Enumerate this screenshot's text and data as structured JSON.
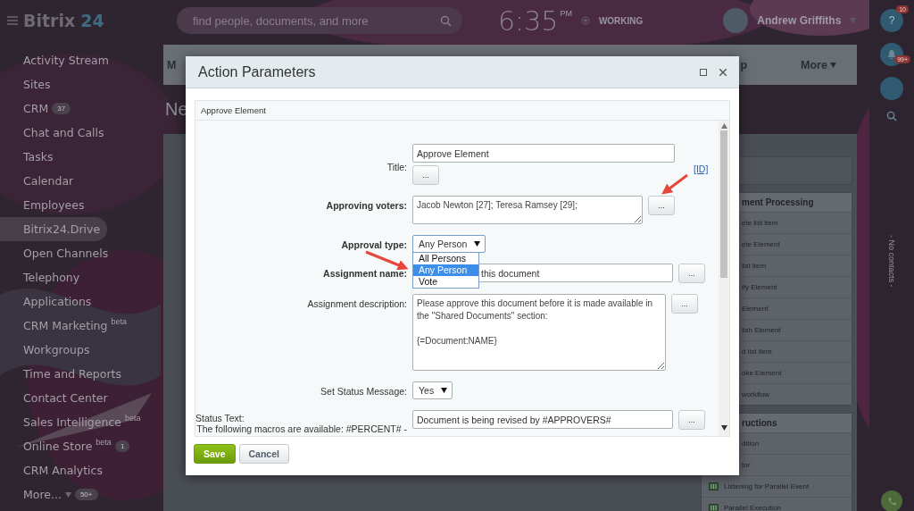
{
  "header": {
    "logo": {
      "name": "Bitrix",
      "number": "24"
    },
    "search": {
      "placeholder": "find people, documents, and more"
    },
    "time": "6:35",
    "meridiem": "PM",
    "work_status": "WORKING",
    "user": "Andrew Griffiths"
  },
  "sidebar": {
    "items": [
      {
        "label": "Activity Stream",
        "selected": false
      },
      {
        "label": "Sites",
        "selected": false
      },
      {
        "label": "CRM",
        "count": "37",
        "selected": false
      },
      {
        "label": "Chat and Calls",
        "selected": false
      },
      {
        "label": "Tasks",
        "selected": false
      },
      {
        "label": "Calendar",
        "selected": false
      },
      {
        "label": "Employees",
        "selected": false
      },
      {
        "label": "Bitrix24.Drive",
        "selected": true
      },
      {
        "label": "Open Channels",
        "selected": false
      },
      {
        "label": "Telephony",
        "selected": false
      },
      {
        "label": "Applications",
        "selected": false
      },
      {
        "label": "CRM Marketing",
        "tag": "beta",
        "selected": false
      },
      {
        "label": "Workgroups",
        "selected": false
      },
      {
        "label": "Time and Reports",
        "selected": false
      },
      {
        "label": "Contact Center",
        "selected": false
      },
      {
        "label": "Sales Intelligence",
        "tag": "beta",
        "selected": false
      },
      {
        "label": "Online Store",
        "tag": "beta",
        "count": "1",
        "selected": false
      },
      {
        "label": "CRM Analytics",
        "selected": false
      },
      {
        "label": "More...",
        "count": "50+",
        "selected": false,
        "expandable": true
      }
    ]
  },
  "background_page": {
    "tabs": [
      "M",
      "p",
      "More"
    ],
    "heading": "Ne",
    "groups": [
      {
        "title": "ment Processing",
        "items": [
          {
            "label": "ete list item",
            "kind": "plain"
          },
          {
            "label": "ete Element",
            "kind": "plain"
          },
          {
            "label": "list item",
            "kind": "plain"
          },
          {
            "label": "ify Element",
            "kind": "plain"
          },
          {
            "label": "Element",
            "kind": "plain"
          },
          {
            "label": "lish Element",
            "kind": "plain"
          },
          {
            "label": "d list item",
            "kind": "plain"
          },
          {
            "label": "oke Element",
            "kind": "plain"
          },
          {
            "label": "workflow",
            "kind": "plain"
          }
        ]
      },
      {
        "title": "ructions",
        "items": [
          {
            "label": "dition",
            "kind": "plain"
          },
          {
            "label": "tor",
            "kind": "plain"
          },
          {
            "label": "Listening for Parallel Event",
            "kind": "icon"
          },
          {
            "label": "Parallel Execution",
            "kind": "icon"
          }
        ]
      }
    ]
  },
  "right_bar": {
    "help_symbol": "?",
    "help_count": "10",
    "notification_count": "99+",
    "contacts_text": "- No contacts -"
  },
  "dialog": {
    "title": "Action Parameters",
    "section": "Approve Element",
    "fields": [
      {
        "kind": "text",
        "label": "Title:",
        "bold": false,
        "value": "Approve Element",
        "button": "...",
        "link": "[ID]"
      },
      {
        "kind": "textarea",
        "label": "Approving voters:",
        "bold": true,
        "value": "Jacob Newton [27]; Teresa Ramsey [29];",
        "button": "...",
        "tall": false
      },
      {
        "kind": "select",
        "label": "Approval type:",
        "bold": true,
        "value": "Any Person",
        "expanded": true,
        "options": [
          {
            "label": "All Persons",
            "selected": false
          },
          {
            "label": "Any Person",
            "selected": true
          },
          {
            "label": "Vote",
            "selected": false
          }
        ]
      },
      {
        "kind": "text",
        "label": "Assignment name:",
        "bold": true,
        "value": "this document",
        "button": "..."
      },
      {
        "kind": "textarea",
        "label": "Assignment description:",
        "bold": false,
        "value": "Please approve this document before it is made available in the \"Shared Documents\" section:\n\n{=Document:NAME}",
        "button": "...",
        "tall": true
      },
      {
        "kind": "select",
        "label": "Set Status Message:",
        "bold": false,
        "value": "Yes",
        "expanded": false
      },
      {
        "kind": "text",
        "label": "Status Text:",
        "note": "The following macros are available: #PERCENT# -",
        "bold": false,
        "value": "Document is being revised by #APPROVERS#",
        "button": "..."
      }
    ],
    "buttons": [
      {
        "label": "Save",
        "primary": true
      },
      {
        "label": "Cancel",
        "primary": false
      }
    ]
  }
}
